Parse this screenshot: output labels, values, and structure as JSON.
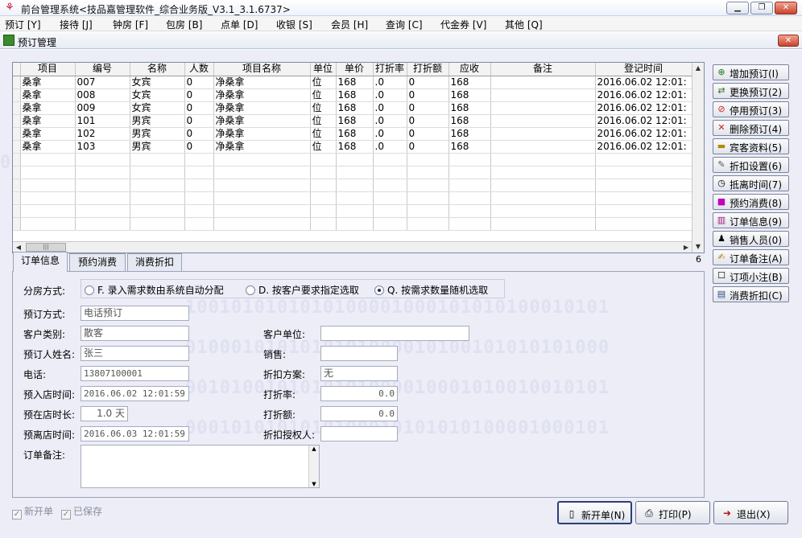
{
  "window": {
    "title": "前台管理系统<技品嘉管理软件_综合业务版_V3.1_3.1.6737>"
  },
  "menu": [
    "预订 [Y]",
    "接待 [J]",
    "钟房 [F]",
    "包房 [B]",
    "点单 [D]",
    "收银 [S]",
    "会员 [H]",
    "查询 [C]",
    "代金券 [V]",
    "其他 [Q]"
  ],
  "subwindow": {
    "title": "预订管理"
  },
  "watermark_lines": [
    "0101010101010101000010001010010010101",
    "1001010101010100001000101010100010101",
    "0100010101010101000010100101010101000",
    "0010100101010101000010001010010010101",
    "0001010101010100010101010100001000101"
  ],
  "grid": {
    "columns": [
      "项目",
      "编号",
      "名称",
      "人数",
      "项目名称",
      "单位",
      "单价",
      "打折率",
      "打折额",
      "应收",
      "备注",
      "登记时间"
    ],
    "rows": [
      [
        "桑拿",
        "007",
        "女宾",
        "0",
        "净桑拿",
        "位",
        "168",
        ".0",
        "0",
        "168",
        "",
        "2016.06.02 12:01:"
      ],
      [
        "桑拿",
        "008",
        "女宾",
        "0",
        "净桑拿",
        "位",
        "168",
        ".0",
        "0",
        "168",
        "",
        "2016.06.02 12:01:"
      ],
      [
        "桑拿",
        "009",
        "女宾",
        "0",
        "净桑拿",
        "位",
        "168",
        ".0",
        "0",
        "168",
        "",
        "2016.06.02 12:01:"
      ],
      [
        "桑拿",
        "101",
        "男宾",
        "0",
        "净桑拿",
        "位",
        "168",
        ".0",
        "0",
        "168",
        "",
        "2016.06.02 12:01:"
      ],
      [
        "桑拿",
        "102",
        "男宾",
        "0",
        "净桑拿",
        "位",
        "168",
        ".0",
        "0",
        "168",
        "",
        "2016.06.02 12:01:"
      ],
      [
        "桑拿",
        "103",
        "男宾",
        "0",
        "净桑拿",
        "位",
        "168",
        ".0",
        "0",
        "168",
        "",
        "2016.06.02 12:01:"
      ]
    ],
    "row_count": "6",
    "hscroll_thumb": "|||"
  },
  "tabs": [
    "订单信息",
    "预约消费",
    "消费折扣"
  ],
  "form": {
    "allocation_label": "分房方式:",
    "allocation_options": [
      "F. 录入需求数由系统自动分配",
      "D. 按客户要求指定选取",
      "Q. 按需求数量随机选取"
    ],
    "booking_method_label": "预订方式:",
    "booking_method": "电话预订",
    "customer_type_label": "客户类别:",
    "customer_type": "散客",
    "customer_unit_label": "客户单位:",
    "customer_unit": "",
    "booker_name_label": "预订人姓名:",
    "booker_name": "张三",
    "sales_label": "销售:",
    "sales": "",
    "phone_label": "电话:",
    "phone": "13807100001",
    "discount_plan_label": "折扣方案:",
    "discount_plan": "无",
    "arrival_label": "预入店时间:",
    "arrival": "2016.06.02 12:01:59",
    "discount_rate_label": "打折率:",
    "discount_rate": "0.0",
    "duration_label": "预在店时长:",
    "duration": "1.0 天",
    "discount_amount_label": "打折额:",
    "discount_amount": "0.0",
    "departure_label": "预离店时间:",
    "departure": "2016.06.03 12:01:59",
    "authorizer_label": "折扣授权人:",
    "authorizer": "",
    "note_label": "订单备注:",
    "note": ""
  },
  "side_buttons": [
    "增加预订(I)",
    "更换预订(2)",
    "停用预订(3)",
    "删除预订(4)",
    "宾客资料(5)",
    "折扣设置(6)",
    "抵离时间(7)",
    "预约消费(8)",
    "订单信息(9)",
    "销售人员(0)",
    "订单备注(A)",
    "订项小注(B)",
    "消费折扣(C)"
  ],
  "checkboxes": [
    "新开单",
    "已保存"
  ],
  "bottom_buttons": {
    "new": "新开单(N)",
    "print": "打印(P)",
    "exit": "退出(X)"
  }
}
